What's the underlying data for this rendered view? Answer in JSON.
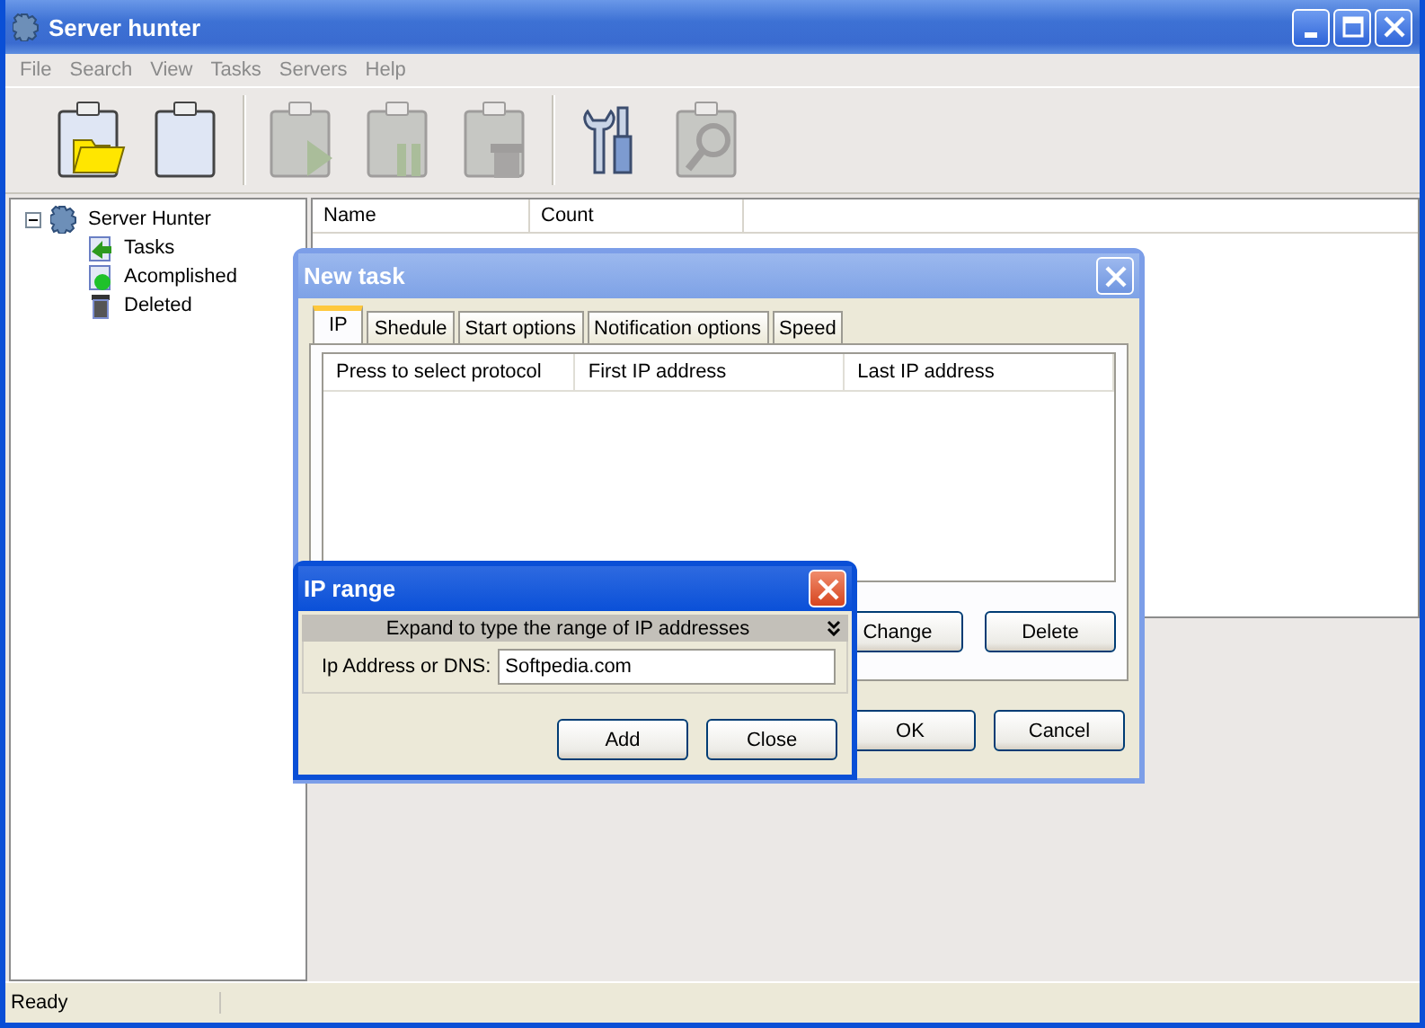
{
  "window": {
    "title": "Server hunter"
  },
  "menu": [
    "File",
    "Search",
    "View",
    "Tasks",
    "Servers",
    "Help"
  ],
  "toolbar": [
    [
      {
        "kind": "open",
        "disabled": false
      },
      {
        "kind": "new",
        "disabled": false
      }
    ],
    [
      {
        "kind": "start",
        "disabled": true
      },
      {
        "kind": "pause",
        "disabled": true
      },
      {
        "kind": "delete",
        "disabled": true
      }
    ],
    [
      {
        "kind": "tools",
        "disabled": false
      },
      {
        "kind": "find",
        "disabled": true
      }
    ]
  ],
  "tree": [
    {
      "label": "Server Hunter",
      "kind": "root",
      "expanded": true,
      "children": [
        {
          "label": "Tasks",
          "kind": "tasks"
        },
        {
          "label": "Acomplished",
          "kind": "done"
        },
        {
          "label": "Deleted",
          "kind": "deleted"
        }
      ]
    }
  ],
  "list": {
    "columns": [
      "Name",
      "Count"
    ]
  },
  "new_task_dialog": {
    "title": "New task",
    "active": false,
    "tabs": [
      {
        "label": "IP",
        "selected": true
      },
      {
        "label": "Shedule",
        "selected": false
      },
      {
        "label": "Start options",
        "selected": false
      },
      {
        "label": "Notification options",
        "selected": false
      },
      {
        "label": "Speed",
        "selected": false
      }
    ],
    "columns": [
      "Press to select protocol",
      "First IP address",
      "Last IP address"
    ],
    "buttons": [
      "Change",
      "Delete"
    ],
    "footer_buttons": [
      "OK",
      "Cancel"
    ]
  },
  "ip_range_dialog": {
    "title": "IP range",
    "active": true,
    "expand_bar": {
      "label": "Expand to type the range of IP addresses",
      "expanded": false
    },
    "field": {
      "label": "Ip Address or DNS:",
      "value": "Softpedia.com"
    },
    "buttons": [
      "Add",
      "Close"
    ]
  },
  "status_bar": [
    "Ready"
  ]
}
